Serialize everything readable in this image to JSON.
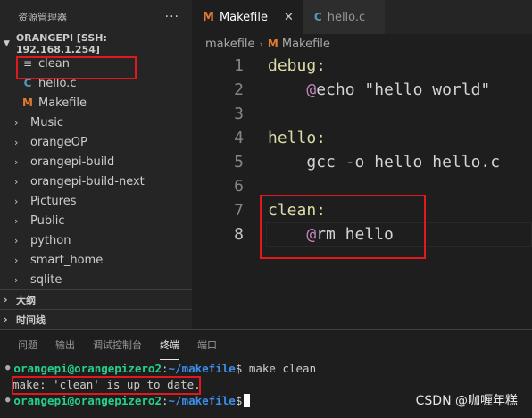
{
  "sidebar": {
    "title": "资源管理器",
    "more": "···",
    "root": "ORANGEPI [SSH: 192.168.1.254]",
    "files": [
      {
        "label": "clean",
        "icon": "lines-icon"
      },
      {
        "label": "hello.c",
        "icon": "c-file-icon"
      },
      {
        "label": "Makefile",
        "icon": "makefile-icon"
      }
    ],
    "folders": [
      "Music",
      "orangeOP",
      "orangepi-build",
      "orangepi-build-next",
      "Pictures",
      "Public",
      "python",
      "smart_home",
      "sqlite"
    ],
    "outline_label": "大纲",
    "timeline_label": "时间线"
  },
  "tabs": [
    {
      "label": "Makefile",
      "active": true,
      "close": "✕"
    },
    {
      "label": "hello.c",
      "active": false
    }
  ],
  "breadcrumb": {
    "folder": "makefile",
    "file": "Makefile",
    "sep": "›"
  },
  "editor": {
    "lines": [
      {
        "n": "1",
        "parts": [
          {
            "t": "debug:",
            "c": "kw-label"
          }
        ]
      },
      {
        "n": "2",
        "parts": [
          {
            "t": "    ",
            "c": "plain"
          },
          {
            "t": "@",
            "c": "kw-at"
          },
          {
            "t": "echo \"hello world\"",
            "c": "plain"
          }
        ]
      },
      {
        "n": "3",
        "parts": []
      },
      {
        "n": "4",
        "parts": [
          {
            "t": "hello:",
            "c": "kw-label"
          }
        ]
      },
      {
        "n": "5",
        "parts": [
          {
            "t": "    gcc -o hello hello.c",
            "c": "plain"
          }
        ]
      },
      {
        "n": "6",
        "parts": []
      },
      {
        "n": "7",
        "parts": [
          {
            "t": "clean:",
            "c": "kw-label"
          }
        ]
      },
      {
        "n": "8",
        "parts": [
          {
            "t": "    ",
            "c": "plain"
          },
          {
            "t": "@",
            "c": "kw-at"
          },
          {
            "t": "rm hello",
            "c": "plain"
          }
        ]
      }
    ],
    "current_line": "8"
  },
  "panel": {
    "tabs": [
      "问题",
      "输出",
      "调试控制台",
      "终端",
      "端口"
    ],
    "active_tab": "终端",
    "terminal": {
      "user": "orangepi@orangepizero2",
      "path": "~/makefile",
      "cmd1": "$ make clean",
      "output": "make: 'clean' is up to date.",
      "prompt_end": "$"
    }
  },
  "watermark": "CSDN @咖喱年糕",
  "colors": {
    "accent_highlight": "#e0191c",
    "terminal_user": "#23d18b",
    "terminal_path": "#3b8eea"
  }
}
